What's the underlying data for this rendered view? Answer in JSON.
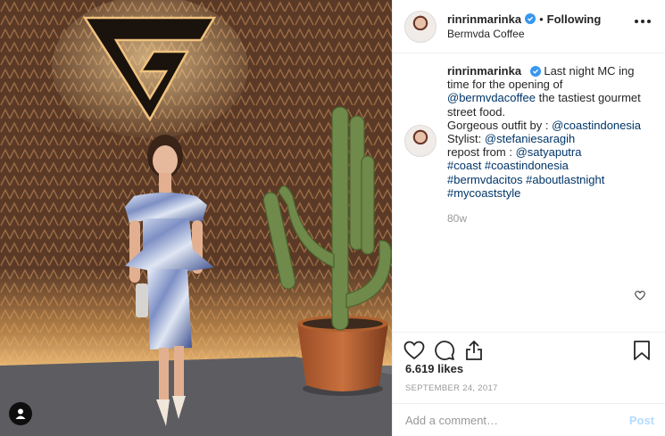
{
  "post": {
    "username": "rinrinmarinka",
    "verified": true,
    "follow_state": "Following",
    "separator": "•",
    "location": "Bermvda Coffee",
    "more_icon": "more-horizontal-icon"
  },
  "caption": {
    "username": "rinrinmarinka",
    "lines": [
      {
        "text": "Last night MC ing"
      },
      {
        "text": "time for the opening of"
      },
      {
        "tag": "@bermvdacoffee",
        "text": " the tastiest gourmet"
      },
      {
        "text": "street food."
      },
      {
        "text": "Gorgeous outfit by : ",
        "tag": "@coastindonesia"
      },
      {
        "text": "Stylist: ",
        "tag": "@stefaniesaragih"
      },
      {
        "text": "repost from : ",
        "tag": "@satyaputra"
      },
      {
        "tag": "#coast #coastindonesia"
      },
      {
        "tag": "#bermvdacitos #aboutlastnight"
      },
      {
        "tag": "#mycoaststyle"
      }
    ],
    "time_ago": "80w"
  },
  "actions": {
    "like_icon": "heart-icon",
    "comment_icon": "comment-icon",
    "share_icon": "share-icon",
    "save_icon": "bookmark-icon"
  },
  "likes": "6.619 likes",
  "date": "SEPTEMBER 24, 2017",
  "comment_box": {
    "placeholder": "Add a comment…",
    "post_label": "Post"
  },
  "colors": {
    "link": "#003569",
    "verified": "#3897f0",
    "post_disabled": "#b3dbff",
    "muted": "#999999"
  }
}
